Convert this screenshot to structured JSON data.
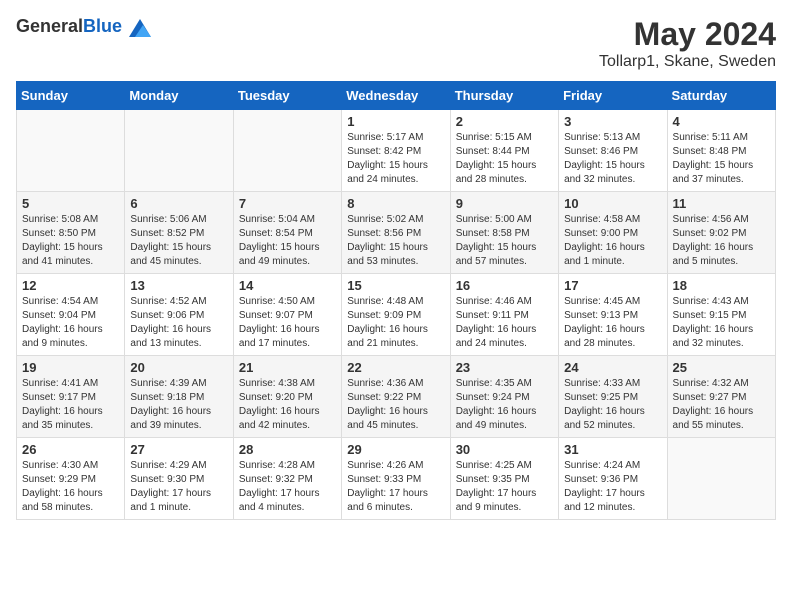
{
  "header": {
    "logo_general": "General",
    "logo_blue": "Blue",
    "month_year": "May 2024",
    "location": "Tollarp1, Skane, Sweden"
  },
  "weekdays": [
    "Sunday",
    "Monday",
    "Tuesday",
    "Wednesday",
    "Thursday",
    "Friday",
    "Saturday"
  ],
  "weeks": [
    [
      {
        "day": "",
        "info": ""
      },
      {
        "day": "",
        "info": ""
      },
      {
        "day": "",
        "info": ""
      },
      {
        "day": "1",
        "info": "Sunrise: 5:17 AM\nSunset: 8:42 PM\nDaylight: 15 hours\nand 24 minutes."
      },
      {
        "day": "2",
        "info": "Sunrise: 5:15 AM\nSunset: 8:44 PM\nDaylight: 15 hours\nand 28 minutes."
      },
      {
        "day": "3",
        "info": "Sunrise: 5:13 AM\nSunset: 8:46 PM\nDaylight: 15 hours\nand 32 minutes."
      },
      {
        "day": "4",
        "info": "Sunrise: 5:11 AM\nSunset: 8:48 PM\nDaylight: 15 hours\nand 37 minutes."
      }
    ],
    [
      {
        "day": "5",
        "info": "Sunrise: 5:08 AM\nSunset: 8:50 PM\nDaylight: 15 hours\nand 41 minutes."
      },
      {
        "day": "6",
        "info": "Sunrise: 5:06 AM\nSunset: 8:52 PM\nDaylight: 15 hours\nand 45 minutes."
      },
      {
        "day": "7",
        "info": "Sunrise: 5:04 AM\nSunset: 8:54 PM\nDaylight: 15 hours\nand 49 minutes."
      },
      {
        "day": "8",
        "info": "Sunrise: 5:02 AM\nSunset: 8:56 PM\nDaylight: 15 hours\nand 53 minutes."
      },
      {
        "day": "9",
        "info": "Sunrise: 5:00 AM\nSunset: 8:58 PM\nDaylight: 15 hours\nand 57 minutes."
      },
      {
        "day": "10",
        "info": "Sunrise: 4:58 AM\nSunset: 9:00 PM\nDaylight: 16 hours\nand 1 minute."
      },
      {
        "day": "11",
        "info": "Sunrise: 4:56 AM\nSunset: 9:02 PM\nDaylight: 16 hours\nand 5 minutes."
      }
    ],
    [
      {
        "day": "12",
        "info": "Sunrise: 4:54 AM\nSunset: 9:04 PM\nDaylight: 16 hours\nand 9 minutes."
      },
      {
        "day": "13",
        "info": "Sunrise: 4:52 AM\nSunset: 9:06 PM\nDaylight: 16 hours\nand 13 minutes."
      },
      {
        "day": "14",
        "info": "Sunrise: 4:50 AM\nSunset: 9:07 PM\nDaylight: 16 hours\nand 17 minutes."
      },
      {
        "day": "15",
        "info": "Sunrise: 4:48 AM\nSunset: 9:09 PM\nDaylight: 16 hours\nand 21 minutes."
      },
      {
        "day": "16",
        "info": "Sunrise: 4:46 AM\nSunset: 9:11 PM\nDaylight: 16 hours\nand 24 minutes."
      },
      {
        "day": "17",
        "info": "Sunrise: 4:45 AM\nSunset: 9:13 PM\nDaylight: 16 hours\nand 28 minutes."
      },
      {
        "day": "18",
        "info": "Sunrise: 4:43 AM\nSunset: 9:15 PM\nDaylight: 16 hours\nand 32 minutes."
      }
    ],
    [
      {
        "day": "19",
        "info": "Sunrise: 4:41 AM\nSunset: 9:17 PM\nDaylight: 16 hours\nand 35 minutes."
      },
      {
        "day": "20",
        "info": "Sunrise: 4:39 AM\nSunset: 9:18 PM\nDaylight: 16 hours\nand 39 minutes."
      },
      {
        "day": "21",
        "info": "Sunrise: 4:38 AM\nSunset: 9:20 PM\nDaylight: 16 hours\nand 42 minutes."
      },
      {
        "day": "22",
        "info": "Sunrise: 4:36 AM\nSunset: 9:22 PM\nDaylight: 16 hours\nand 45 minutes."
      },
      {
        "day": "23",
        "info": "Sunrise: 4:35 AM\nSunset: 9:24 PM\nDaylight: 16 hours\nand 49 minutes."
      },
      {
        "day": "24",
        "info": "Sunrise: 4:33 AM\nSunset: 9:25 PM\nDaylight: 16 hours\nand 52 minutes."
      },
      {
        "day": "25",
        "info": "Sunrise: 4:32 AM\nSunset: 9:27 PM\nDaylight: 16 hours\nand 55 minutes."
      }
    ],
    [
      {
        "day": "26",
        "info": "Sunrise: 4:30 AM\nSunset: 9:29 PM\nDaylight: 16 hours\nand 58 minutes."
      },
      {
        "day": "27",
        "info": "Sunrise: 4:29 AM\nSunset: 9:30 PM\nDaylight: 17 hours\nand 1 minute."
      },
      {
        "day": "28",
        "info": "Sunrise: 4:28 AM\nSunset: 9:32 PM\nDaylight: 17 hours\nand 4 minutes."
      },
      {
        "day": "29",
        "info": "Sunrise: 4:26 AM\nSunset: 9:33 PM\nDaylight: 17 hours\nand 6 minutes."
      },
      {
        "day": "30",
        "info": "Sunrise: 4:25 AM\nSunset: 9:35 PM\nDaylight: 17 hours\nand 9 minutes."
      },
      {
        "day": "31",
        "info": "Sunrise: 4:24 AM\nSunset: 9:36 PM\nDaylight: 17 hours\nand 12 minutes."
      },
      {
        "day": "",
        "info": ""
      }
    ]
  ]
}
